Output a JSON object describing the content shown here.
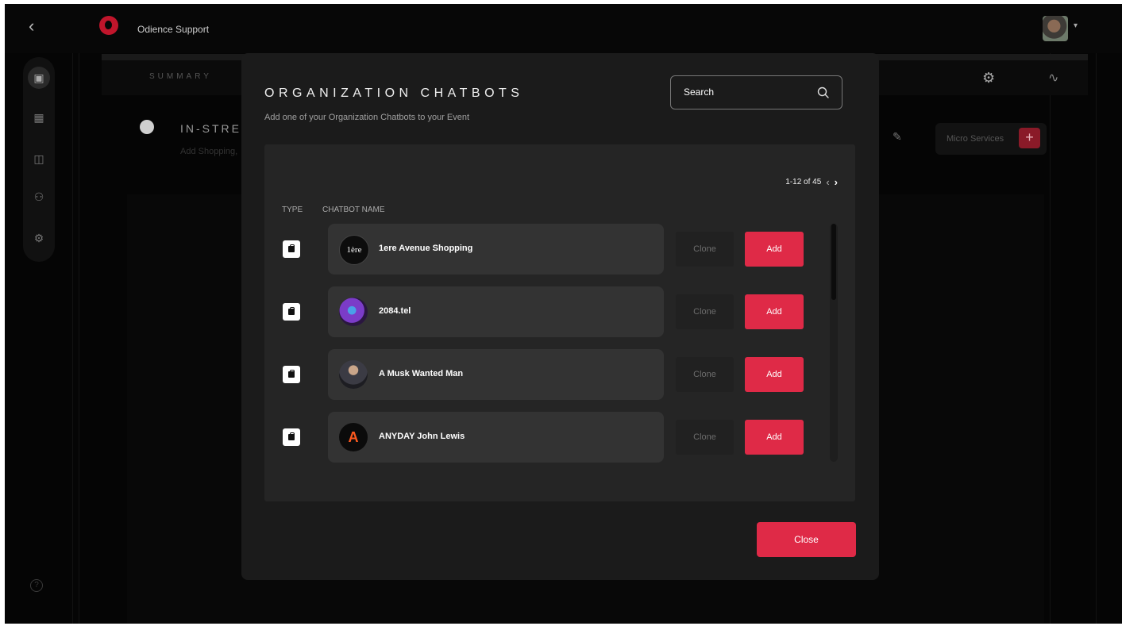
{
  "app": {
    "org_name": "Odience Support",
    "back_icon": "chevron-left-icon"
  },
  "background": {
    "summary_label": "SUMMARY",
    "section_title": "IN-STREA",
    "section_subtitle": "Add Shopping,",
    "micro_services_label": "Micro Services"
  },
  "modal": {
    "title": "ORGANIZATION CHATBOTS",
    "subtitle": "Add one of your Organization Chatbots to your Event",
    "search_placeholder": "Search",
    "pagination": "1-12 of 45",
    "columns": {
      "type": "TYPE",
      "name": "CHATBOT NAME"
    },
    "rows": [
      {
        "name": "1ere Avenue Shopping",
        "type": "shopping-bag-icon",
        "logo_text": "1ère"
      },
      {
        "name": "2084.tel",
        "type": "shopping-bag-icon"
      },
      {
        "name": "A Musk Wanted Man",
        "type": "shopping-bag-icon"
      },
      {
        "name": "ANYDAY John Lewis",
        "type": "shopping-bag-icon",
        "logo_text": "A"
      }
    ],
    "clone_label": "Clone",
    "add_label": "Add",
    "close_label": "Close"
  },
  "colors": {
    "accent": "#df2a47",
    "modal_bg": "#1b1b1b",
    "panel_bg": "#252525",
    "card_bg": "#333333"
  }
}
